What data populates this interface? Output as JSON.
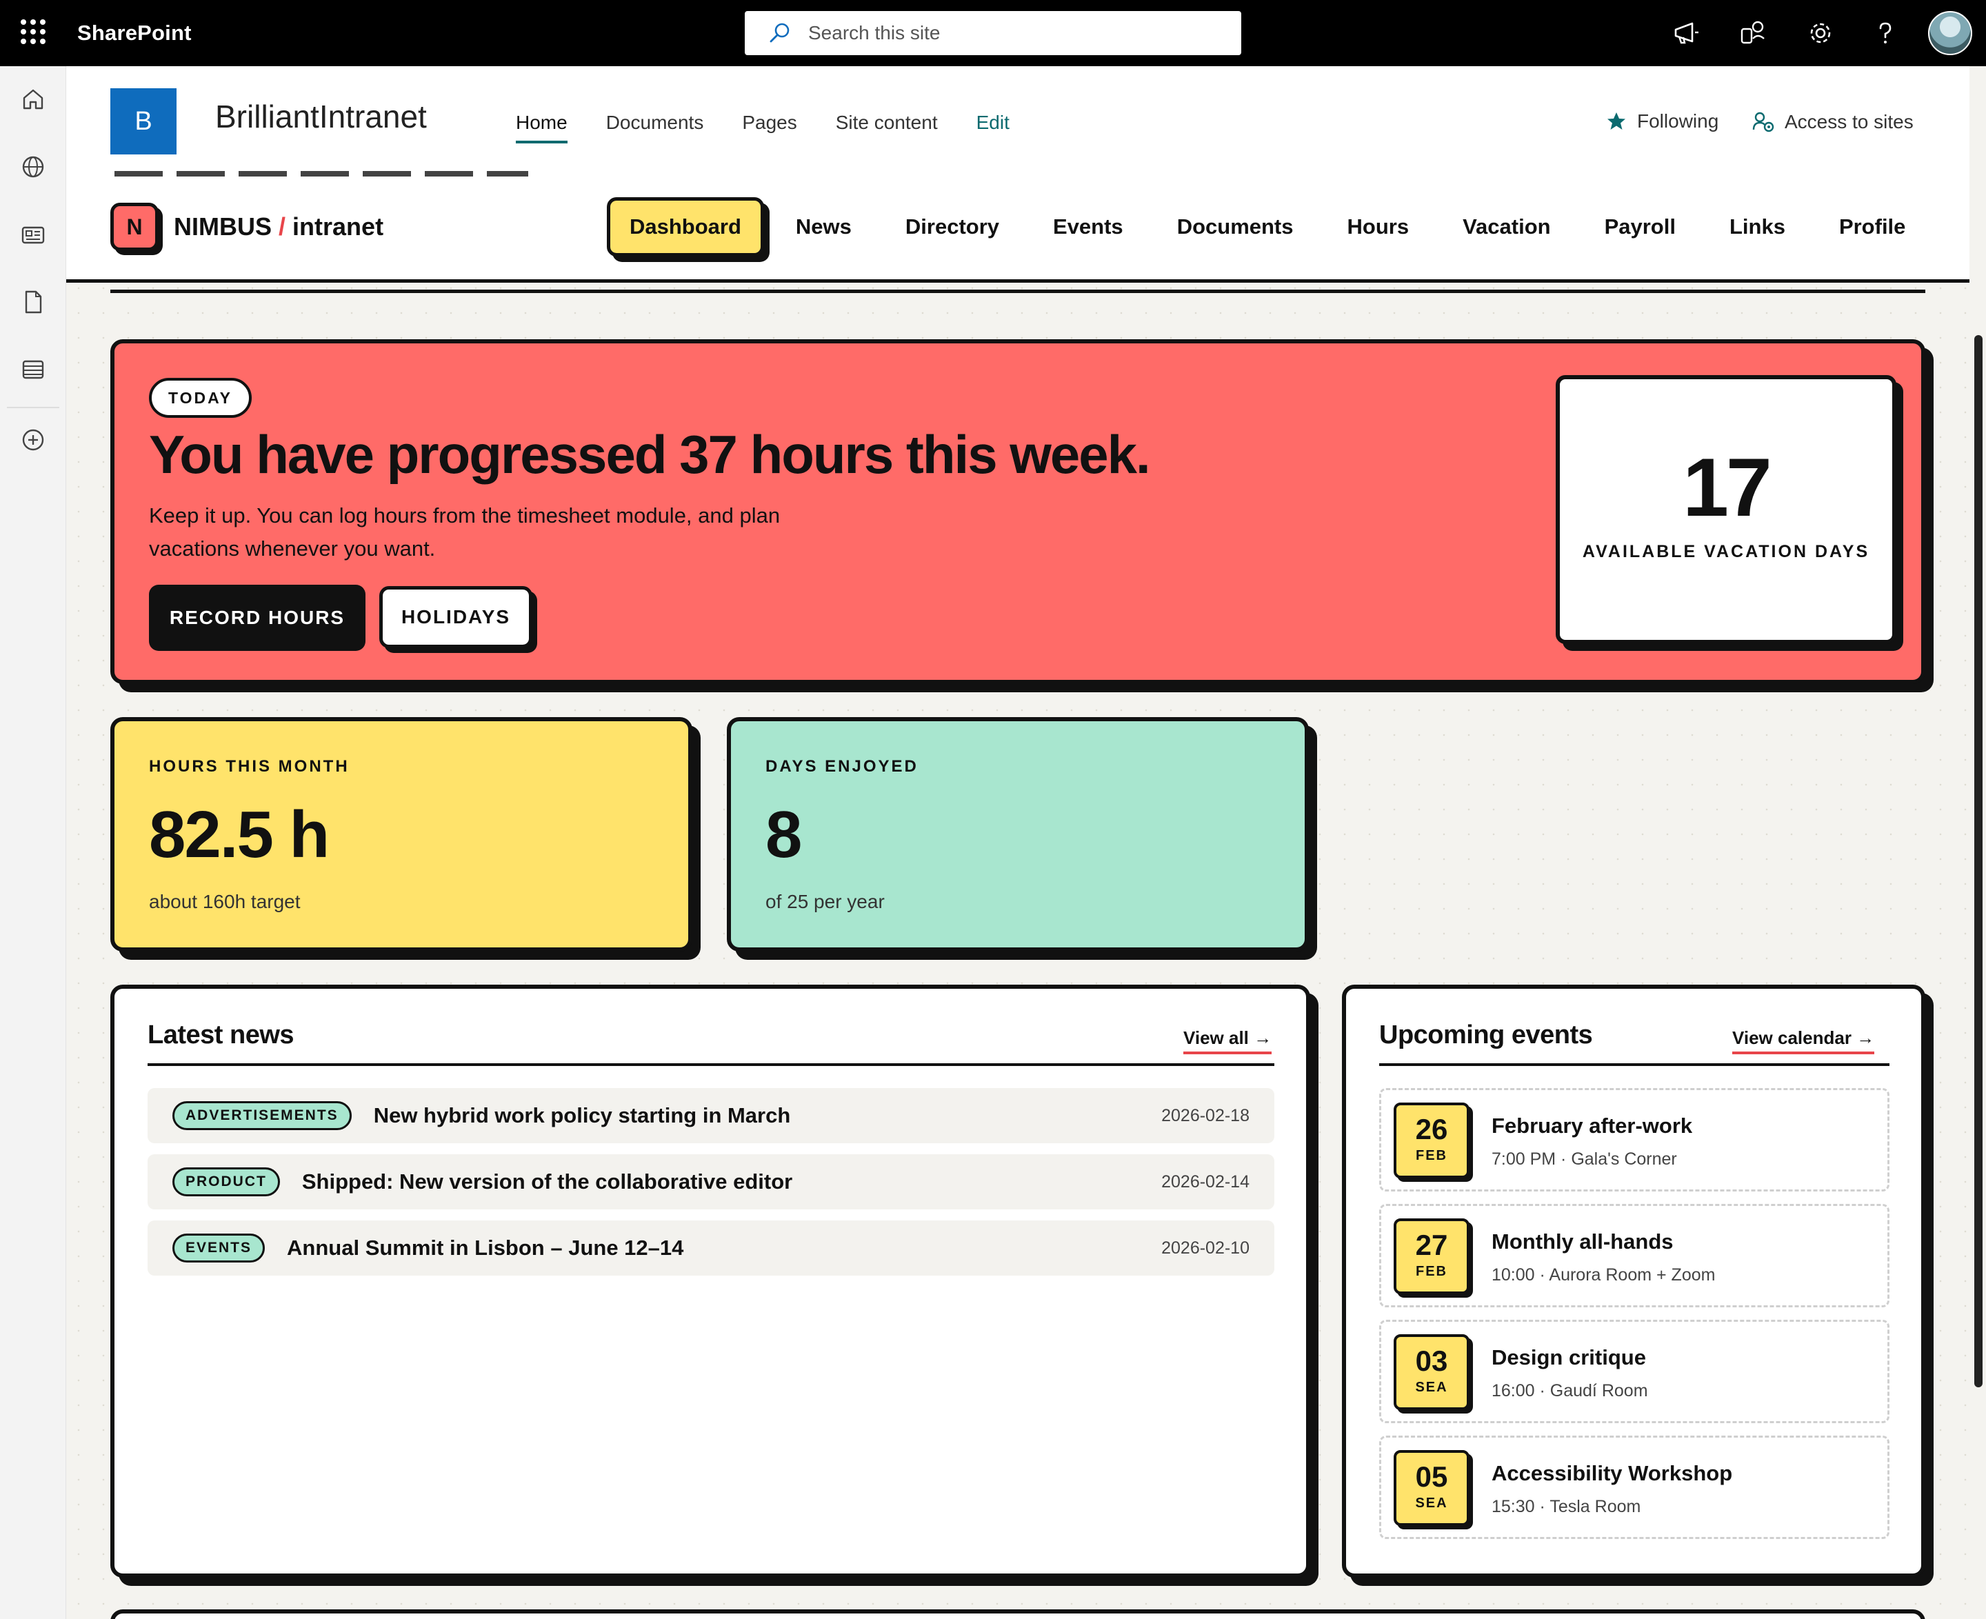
{
  "suite": {
    "brand": "SharePoint",
    "search_placeholder": "Search this site"
  },
  "site": {
    "logo_letter": "B",
    "title": "BrilliantIntranet",
    "nav": [
      "Home",
      "Documents",
      "Pages",
      "Site content",
      "Edit"
    ],
    "following_label": "Following",
    "access_label": "Access to sites"
  },
  "intranet": {
    "logo_letter": "N",
    "brand_name": "NIMBUS",
    "brand_sep": "/",
    "brand_suffix": "intranet",
    "nav": [
      "Dashboard",
      "News",
      "Directory",
      "Events",
      "Documents",
      "Hours",
      "Vacation",
      "Payroll",
      "Links",
      "Profile"
    ],
    "active_nav": "Dashboard"
  },
  "hero": {
    "pill": "TODAY",
    "headline": "You have progressed 37 hours this week.",
    "body": "Keep it up. You can log hours from the timesheet module, and plan vacations whenever you want.",
    "primary_button": "RECORD HOURS",
    "secondary_button": "HOLIDAYS",
    "vacation_days": "17",
    "vacation_label": "AVAILABLE VACATION DAYS"
  },
  "stats": [
    {
      "label": "HOURS THIS MONTH",
      "value": "82.5 h",
      "sub": "about 160h target"
    },
    {
      "label": "DAYS ENJOYED",
      "value": "8",
      "sub": "of 25 per year"
    }
  ],
  "news": {
    "title": "Latest news",
    "view_all": "View all →",
    "items": [
      {
        "tag": "ADVERTISEMENTS",
        "title": "New hybrid work policy starting in March",
        "date": "2026-02-18"
      },
      {
        "tag": "PRODUCT",
        "title": "Shipped: New version of the collaborative editor",
        "date": "2026-02-14"
      },
      {
        "tag": "EVENTS",
        "title": "Annual Summit in Lisbon – June 12–14",
        "date": "2026-02-10"
      }
    ]
  },
  "events": {
    "title": "Upcoming events",
    "view_calendar": "View calendar →",
    "items": [
      {
        "day": "26",
        "month": "FEB",
        "title": "February after-work",
        "meta": "7:00 PM · Gala's Corner"
      },
      {
        "day": "27",
        "month": "FEB",
        "title": "Monthly all-hands",
        "meta": "10:00 · Aurora Room + Zoom"
      },
      {
        "day": "03",
        "month": "SEA",
        "title": "Design critique",
        "meta": "16:00 · Gaudí Room"
      },
      {
        "day": "05",
        "month": "SEA",
        "title": "Accessibility Workshop",
        "meta": "15:30 · Tesla Room"
      }
    ]
  },
  "colors": {
    "coral": "#ff6b68",
    "yellow": "#ffe36b",
    "mint": "#a8e6cf",
    "ink": "#111111",
    "sp_teal": "#0b6a6f",
    "sp_blue": "#0f6cbd"
  }
}
